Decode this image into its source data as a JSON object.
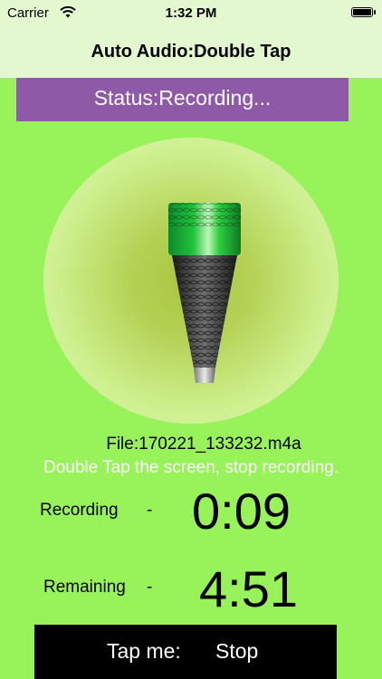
{
  "status_bar": {
    "carrier": "Carrier",
    "time": "1:32 PM"
  },
  "nav": {
    "title": "Auto Audio:Double Tap"
  },
  "status": {
    "text": "Status:Recording..."
  },
  "file": {
    "label": "File:170221_133232.m4a"
  },
  "instruction": {
    "text": "Double Tap the screen, stop recording."
  },
  "recording": {
    "label": "Recording",
    "dash": "-",
    "time": "0:09"
  },
  "remaining": {
    "label": "Remaining",
    "dash": "-",
    "time": "4:51"
  },
  "stop_button": {
    "tap_label": "Tap me:",
    "stop_label": "Stop"
  },
  "colors": {
    "background": "#98f25a",
    "banner": "#8e5aa8",
    "navbar": "#e4f8cf",
    "button": "#000000"
  },
  "icons": {
    "wifi": "wifi-icon",
    "battery": "battery-icon",
    "microphone": "microphone-icon"
  }
}
